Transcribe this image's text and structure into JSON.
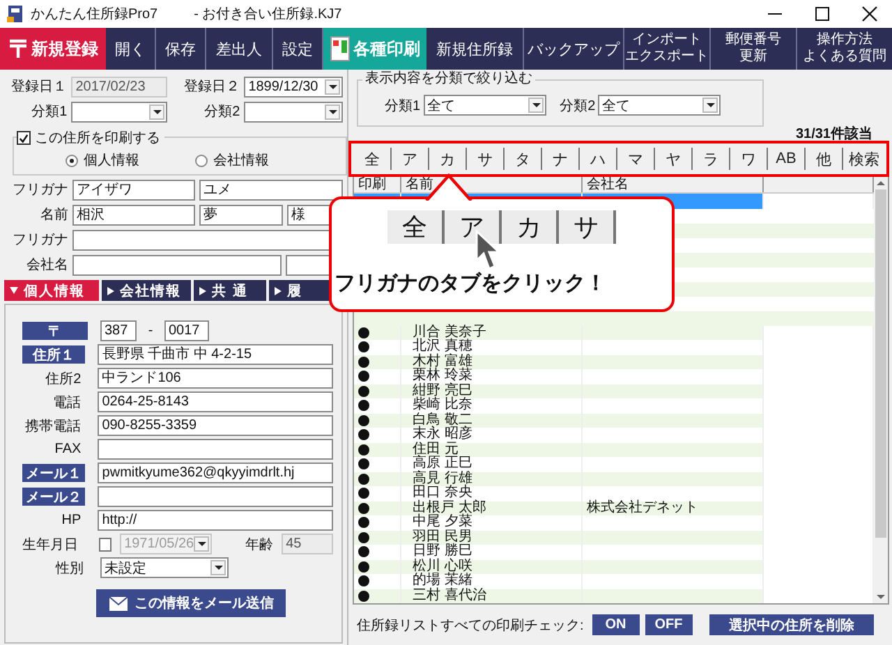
{
  "window": {
    "title": "かんたん住所録Pro7",
    "file": "- お付き合い住所録.KJ7"
  },
  "toolbar": [
    {
      "kind": "new",
      "label": "新規登録"
    },
    {
      "kind": "plain",
      "label": "開く"
    },
    {
      "kind": "plain",
      "label": "保存"
    },
    {
      "kind": "plain",
      "label": "差出人"
    },
    {
      "kind": "plain",
      "label": "設定"
    },
    {
      "kind": "print",
      "label": "各種印刷"
    },
    {
      "kind": "plain",
      "label": "新規住所録"
    },
    {
      "kind": "plain",
      "label": "バックアップ"
    },
    {
      "kind": "small",
      "lines": [
        "インポート",
        "エクスポート"
      ]
    },
    {
      "kind": "small",
      "lines": [
        "郵便番号",
        "更新"
      ]
    },
    {
      "kind": "small",
      "lines": [
        "操作方法",
        "よくある質問"
      ]
    }
  ],
  "record": {
    "top_rows": [
      [
        {
          "label": "登録日１",
          "kind": "readonly",
          "value": "2017/02/23"
        },
        {
          "label": "登録日２",
          "kind": "combo",
          "value": "1899/12/30"
        }
      ],
      [
        {
          "label": "分類1",
          "kind": "combo"
        },
        {
          "label": "分類2",
          "kind": "combo"
        }
      ]
    ],
    "print_option": {
      "label": "この住所を印刷する",
      "checked": true,
      "options": [
        {
          "label": "個人情報",
          "selected": true
        },
        {
          "label": "会社情報",
          "selected": false
        }
      ]
    },
    "name_rows": [
      {
        "label": "フリガナ",
        "kind": "pair",
        "values": [
          "アイザワ",
          "ユメ"
        ]
      },
      {
        "label": "名前",
        "kind": "triple",
        "values": [
          "相沢",
          "夢",
          "様"
        ]
      },
      {
        "label": "フリガナ",
        "kind": "single"
      },
      {
        "label": "会社名",
        "kind": "company"
      }
    ],
    "section_tabs": [
      {
        "label": "個人情報",
        "selected": true
      },
      {
        "label": "会社情報",
        "selected": false
      },
      {
        "label": "共 通",
        "selected": false
      },
      {
        "label": "履",
        "selected": false
      }
    ],
    "contact": [
      {
        "label": "〒",
        "kind": "postal",
        "button": true,
        "values": [
          "387",
          "0017"
        ],
        "separator": "-"
      },
      {
        "label": "住所１",
        "kind": "text",
        "button": true,
        "value": "長野県 千曲市 中 4-2-15"
      },
      {
        "label": "住所2",
        "kind": "text",
        "button": false,
        "value": "中ランド106"
      },
      {
        "label": "電話",
        "kind": "text",
        "button": false,
        "value": "0264-25-8143"
      },
      {
        "label": "携帯電話",
        "kind": "text",
        "button": false,
        "value": "090-8255-3359"
      },
      {
        "label": "FAX",
        "kind": "text",
        "button": false
      },
      {
        "label": "メール１",
        "kind": "text",
        "button": true,
        "value": "pwmitkyume362@qkyyimdrlt.hj"
      },
      {
        "label": "メール２",
        "kind": "text",
        "button": true
      },
      {
        "label": "HP",
        "kind": "text",
        "button": false,
        "value": "http://"
      },
      {
        "label": "生年月日",
        "kind": "birthday",
        "button": false,
        "checked": false,
        "value": "1971/05/26",
        "age_label": "年齢",
        "age": "45"
      },
      {
        "label": "性別",
        "kind": "combo",
        "button": false,
        "value": "未設定"
      }
    ],
    "mail_button": "この情報をメール送信"
  },
  "filter": {
    "title": "表示内容を分類で絞り込む",
    "combos": [
      {
        "label": "分類1",
        "value": "全て"
      },
      {
        "label": "分類2",
        "value": "全て"
      }
    ]
  },
  "count": "31/31件該当",
  "kana_tabs": [
    {
      "label": "全",
      "selected": false
    },
    {
      "label": "ア",
      "selected": false
    },
    {
      "label": "カ",
      "selected": false
    },
    {
      "label": "サ",
      "selected": false
    },
    {
      "label": "タ",
      "selected": false
    },
    {
      "label": "ナ",
      "selected": false
    },
    {
      "label": "ハ",
      "selected": false
    },
    {
      "label": "マ",
      "selected": false
    },
    {
      "label": "ヤ",
      "selected": false
    },
    {
      "label": "ラ",
      "selected": false
    },
    {
      "label": "ワ",
      "selected": false
    },
    {
      "label": "AB",
      "selected": false
    },
    {
      "label": "他",
      "selected": false
    },
    {
      "label": "検索",
      "selected": false
    }
  ],
  "table": {
    "columns": [
      "印刷",
      "名前",
      "会社名"
    ],
    "rows": [
      {
        "selected": true
      },
      {
        "selected": false,
        "printed": true,
        "name": "川合 美奈子"
      },
      {
        "selected": false,
        "printed": true,
        "name": "北沢 真穂"
      },
      {
        "selected": false,
        "printed": true,
        "name": "木村 富雄"
      },
      {
        "selected": false,
        "printed": true,
        "name": "栗林 玲菜"
      },
      {
        "selected": false,
        "printed": true,
        "name": "紺野 亮巳"
      },
      {
        "selected": false,
        "printed": true,
        "name": "柴崎 比奈"
      },
      {
        "selected": false,
        "printed": true,
        "name": "白鳥 敬二"
      },
      {
        "selected": false,
        "printed": true,
        "name": "末永 昭彦"
      },
      {
        "selected": false,
        "printed": true,
        "name": "住田 元"
      },
      {
        "selected": false,
        "printed": true,
        "name": "高原 正巳"
      },
      {
        "selected": false,
        "printed": true,
        "name": "高見 行雄"
      },
      {
        "selected": false,
        "printed": true,
        "name": "田口 奈央"
      },
      {
        "selected": false,
        "printed": true,
        "name": "出根戸 太郎",
        "company": "株式会社デネット"
      },
      {
        "selected": false,
        "printed": true,
        "name": "中尾 夕菜"
      },
      {
        "selected": false,
        "printed": true,
        "name": "羽田 民男"
      },
      {
        "selected": false,
        "printed": true,
        "name": "日野 勝巳"
      },
      {
        "selected": false,
        "printed": true,
        "name": "松川 心咲"
      },
      {
        "selected": false,
        "printed": true,
        "name": "的場 茉緒"
      },
      {
        "selected": false,
        "printed": true,
        "name": "三村 喜代治"
      }
    ]
  },
  "bottom_bar": {
    "label": "住所録リストすべての印刷チェック:",
    "buttons": [
      "ON",
      "OFF"
    ],
    "delete": "選択中の住所を削除"
  },
  "callout": {
    "tabs": [
      "全",
      "ア",
      "カ",
      "サ"
    ],
    "text": "フリガナのタブをクリック！"
  }
}
